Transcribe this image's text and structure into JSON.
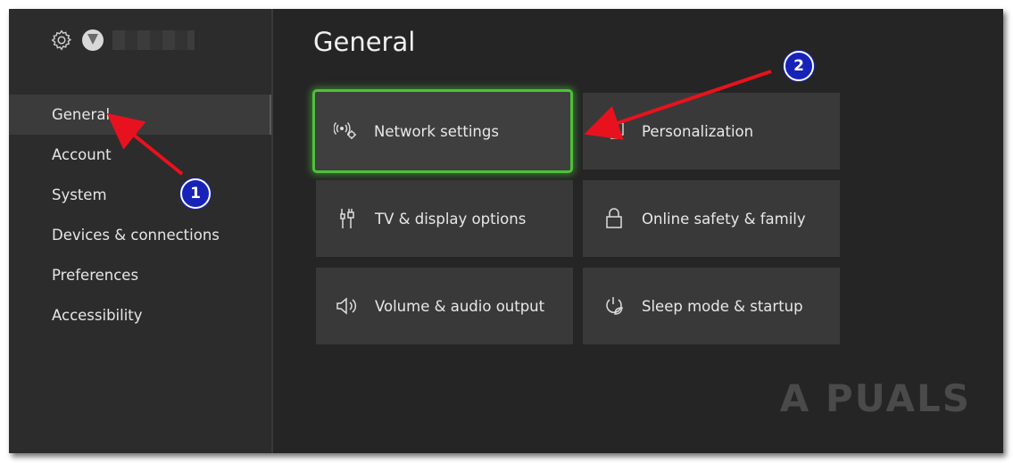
{
  "sidebar": {
    "items": [
      {
        "label": "General",
        "active": true
      },
      {
        "label": "Account"
      },
      {
        "label": "System"
      },
      {
        "label": "Devices & connections"
      },
      {
        "label": "Preferences"
      },
      {
        "label": "Accessibility"
      }
    ]
  },
  "main": {
    "title": "General",
    "tiles": [
      {
        "label": "Network settings",
        "icon": "network-icon",
        "focused": true
      },
      {
        "label": "Personalization",
        "icon": "personalization-icon"
      },
      {
        "label": "TV & display options",
        "icon": "tv-display-icon"
      },
      {
        "label": "Online safety & family",
        "icon": "lock-icon"
      },
      {
        "label": "Volume & audio output",
        "icon": "speaker-icon"
      },
      {
        "label": "Sleep mode & startup",
        "icon": "power-leaf-icon"
      }
    ]
  },
  "annotations": {
    "badge_1": "1",
    "badge_2": "2",
    "arrow_color": "#e8121e",
    "badge_color": "#1723b8"
  },
  "watermark": "A PUALS",
  "accent_color": "#4ec13a"
}
